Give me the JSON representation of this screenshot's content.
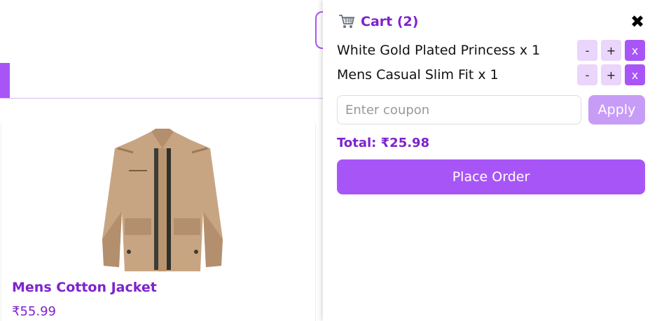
{
  "product": {
    "title": "Mens Cotton Jacket",
    "price": "₹55.99"
  },
  "cart": {
    "icon": "shopping-cart-icon",
    "title": "Cart (2)",
    "close_label": "✖",
    "items": [
      {
        "label": "White Gold Plated Princess x 1",
        "decrement": "-",
        "increment": "+",
        "remove": "x"
      },
      {
        "label": "Mens Casual Slim Fit x 1",
        "decrement": "-",
        "increment": "+",
        "remove": "x"
      }
    ],
    "coupon_placeholder": "Enter coupon",
    "apply_label": "Apply",
    "total": "Total: ₹25.98",
    "place_order_label": "Place Order"
  },
  "colors": {
    "accent": "#a855f7",
    "accent_dark": "#7e22ce",
    "accent_light": "#ead5fb"
  }
}
